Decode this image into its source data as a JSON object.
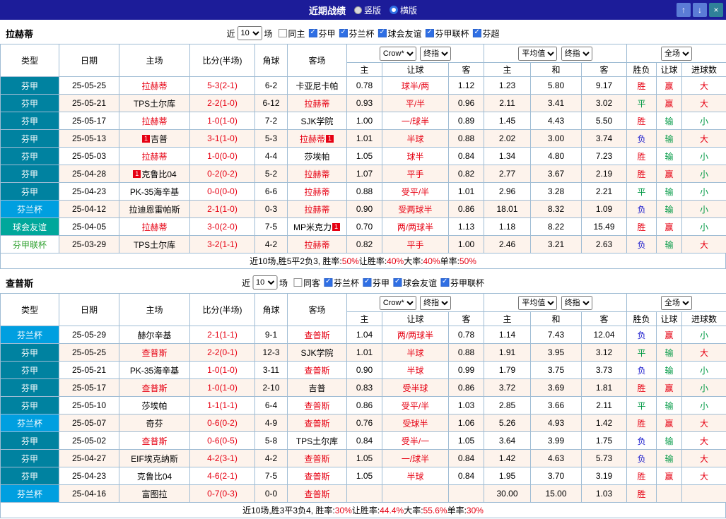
{
  "topbar": {
    "title": "近期战绩",
    "radios": [
      {
        "label": "竖版",
        "selected": false
      },
      {
        "label": "横版",
        "selected": true
      }
    ],
    "buttons": {
      "up": "↑",
      "down": "↓",
      "close": "×"
    }
  },
  "columns": {
    "type": "类型",
    "date": "日期",
    "home": "主场",
    "score": "比分(半场)",
    "corner": "角球",
    "away": "客场",
    "bookmaker": "Crow*",
    "final_index": "终指",
    "average": "平均值",
    "final_index2": "终指",
    "full_match": "全场",
    "odds_sub": [
      "主",
      "让球",
      "客"
    ],
    "avg_sub": [
      "主",
      "和",
      "客"
    ],
    "result_sub": [
      "胜负",
      "让球",
      "进球数"
    ]
  },
  "sections": [
    {
      "team": "拉赫蒂",
      "filter": {
        "near_label": "近",
        "count": "10",
        "matches_label": "场",
        "same_venue": {
          "label": "同主",
          "checked": false
        },
        "leagues": [
          {
            "label": "芬甲",
            "checked": true
          },
          {
            "label": "芬兰杯",
            "checked": true
          },
          {
            "label": "球会友谊",
            "checked": true
          },
          {
            "label": "芬甲联杯",
            "checked": true
          },
          {
            "label": "芬超",
            "checked": true
          }
        ]
      },
      "rows": [
        {
          "league": "芬甲",
          "date": "25-05-25",
          "home": {
            "name": "拉赫蒂",
            "focus": true
          },
          "score": "5-3(2-1)",
          "corner": "6-2",
          "away": {
            "name": "卡亚尼卡帕",
            "focus": false
          },
          "odds": {
            "home": "0.78",
            "handicap": "球半/两",
            "away": "1.12"
          },
          "avg": {
            "home": "1.23",
            "draw": "5.80",
            "away": "9.17"
          },
          "result": "胜",
          "handicap_result": "赢",
          "goals": "大"
        },
        {
          "league": "芬甲",
          "date": "25-05-21",
          "home": {
            "name": "TPS土尔库",
            "focus": false
          },
          "score": "2-2(1-0)",
          "corner": "6-12",
          "away": {
            "name": "拉赫蒂",
            "focus": true
          },
          "odds": {
            "home": "0.93",
            "handicap": "平/半",
            "away": "0.96"
          },
          "avg": {
            "home": "2.11",
            "draw": "3.41",
            "away": "3.02"
          },
          "result": "平",
          "handicap_result": "赢",
          "goals": "大"
        },
        {
          "league": "芬甲",
          "date": "25-05-17",
          "home": {
            "name": "拉赫蒂",
            "focus": true
          },
          "score": "1-0(1-0)",
          "corner": "7-2",
          "away": {
            "name": "SJK学院",
            "focus": false
          },
          "odds": {
            "home": "1.00",
            "handicap": "一/球半",
            "away": "0.89"
          },
          "avg": {
            "home": "1.45",
            "draw": "4.43",
            "away": "5.50"
          },
          "result": "胜",
          "handicap_result": "输",
          "goals": "小"
        },
        {
          "league": "芬甲",
          "date": "25-05-13",
          "home": {
            "name": "吉普",
            "focus": false,
            "badge_pre": "1"
          },
          "score": "3-1(1-0)",
          "corner": "5-3",
          "away": {
            "name": "拉赫蒂",
            "focus": true,
            "badge_post": "1"
          },
          "odds": {
            "home": "1.01",
            "handicap": "半球",
            "away": "0.88"
          },
          "avg": {
            "home": "2.02",
            "draw": "3.00",
            "away": "3.74"
          },
          "result": "负",
          "handicap_result": "输",
          "goals": "大"
        },
        {
          "league": "芬甲",
          "date": "25-05-03",
          "home": {
            "name": "拉赫蒂",
            "focus": true
          },
          "score": "1-0(0-0)",
          "corner": "4-4",
          "away": {
            "name": "莎埃帕",
            "focus": false
          },
          "odds": {
            "home": "1.05",
            "handicap": "球半",
            "away": "0.84"
          },
          "avg": {
            "home": "1.34",
            "draw": "4.80",
            "away": "7.23"
          },
          "result": "胜",
          "handicap_result": "输",
          "goals": "小"
        },
        {
          "league": "芬甲",
          "date": "25-04-28",
          "home": {
            "name": "克鲁比04",
            "focus": false,
            "badge_pre": "1"
          },
          "score": "0-2(0-2)",
          "corner": "5-2",
          "away": {
            "name": "拉赫蒂",
            "focus": true
          },
          "odds": {
            "home": "1.07",
            "handicap": "平手",
            "away": "0.82"
          },
          "avg": {
            "home": "2.77",
            "draw": "3.67",
            "away": "2.19"
          },
          "result": "胜",
          "handicap_result": "赢",
          "goals": "小"
        },
        {
          "league": "芬甲",
          "date": "25-04-23",
          "home": {
            "name": "PK-35海辛基",
            "focus": false
          },
          "score": "0-0(0-0)",
          "corner": "6-6",
          "away": {
            "name": "拉赫蒂",
            "focus": true
          },
          "odds": {
            "home": "0.88",
            "handicap": "受平/半",
            "away": "1.01"
          },
          "avg": {
            "home": "2.96",
            "draw": "3.28",
            "away": "2.21"
          },
          "result": "平",
          "handicap_result": "输",
          "goals": "小"
        },
        {
          "league": "芬兰杯",
          "date": "25-04-12",
          "home": {
            "name": "拉迪恩雷帕斯",
            "focus": false
          },
          "score": "2-1(1-0)",
          "corner": "0-3",
          "away": {
            "name": "拉赫蒂",
            "focus": true
          },
          "odds": {
            "home": "0.90",
            "handicap": "受两球半",
            "away": "0.86"
          },
          "avg": {
            "home": "18.01",
            "draw": "8.32",
            "away": "1.09"
          },
          "result": "负",
          "handicap_result": "输",
          "goals": "小"
        },
        {
          "league": "球会友谊",
          "date": "25-04-05",
          "home": {
            "name": "拉赫蒂",
            "focus": true
          },
          "score": "3-0(2-0)",
          "corner": "7-5",
          "away": {
            "name": "MP米克力",
            "focus": false,
            "badge_post": "1"
          },
          "odds": {
            "home": "0.70",
            "handicap": "两/两球半",
            "away": "1.13"
          },
          "avg": {
            "home": "1.18",
            "draw": "8.22",
            "away": "15.49"
          },
          "result": "胜",
          "handicap_result": "赢",
          "goals": "小"
        },
        {
          "league": "芬甲联杯",
          "date": "25-03-29",
          "home": {
            "name": "TPS土尔库",
            "focus": false
          },
          "score": "3-2(1-1)",
          "corner": "4-2",
          "away": {
            "name": "拉赫蒂",
            "focus": true
          },
          "odds": {
            "home": "0.82",
            "handicap": "平手",
            "away": "1.00"
          },
          "avg": {
            "home": "2.46",
            "draw": "3.21",
            "away": "2.63"
          },
          "result": "负",
          "handicap_result": "输",
          "goals": "大"
        }
      ],
      "summary": [
        {
          "text": "近10场,胜5平2负3, 胜率:",
          "red": false
        },
        {
          "text": "50%",
          "red": true
        },
        {
          "text": " 让胜率:",
          "red": false
        },
        {
          "text": "40%",
          "red": true
        },
        {
          "text": " 大率:",
          "red": false
        },
        {
          "text": "40%",
          "red": true
        },
        {
          "text": " 单率:",
          "red": false
        },
        {
          "text": "50%",
          "red": true
        }
      ]
    },
    {
      "team": "查普斯",
      "filter": {
        "near_label": "近",
        "count": "10",
        "matches_label": "场",
        "same_venue": {
          "label": "同客",
          "checked": false
        },
        "leagues": [
          {
            "label": "芬兰杯",
            "checked": true
          },
          {
            "label": "芬甲",
            "checked": true
          },
          {
            "label": "球会友谊",
            "checked": true
          },
          {
            "label": "芬甲联杯",
            "checked": true
          }
        ]
      },
      "rows": [
        {
          "league": "芬兰杯",
          "date": "25-05-29",
          "home": {
            "name": "赫尔辛基",
            "focus": false
          },
          "score": "2-1(1-1)",
          "corner": "9-1",
          "away": {
            "name": "查普斯",
            "focus": true
          },
          "odds": {
            "home": "1.04",
            "handicap": "两/两球半",
            "away": "0.78"
          },
          "avg": {
            "home": "1.14",
            "draw": "7.43",
            "away": "12.04"
          },
          "result": "负",
          "handicap_result": "赢",
          "goals": "小"
        },
        {
          "league": "芬甲",
          "date": "25-05-25",
          "home": {
            "name": "查普斯",
            "focus": true
          },
          "score": "2-2(0-1)",
          "corner": "12-3",
          "away": {
            "name": "SJK学院",
            "focus": false
          },
          "odds": {
            "home": "1.01",
            "handicap": "半球",
            "away": "0.88"
          },
          "avg": {
            "home": "1.91",
            "draw": "3.95",
            "away": "3.12"
          },
          "result": "平",
          "handicap_result": "输",
          "goals": "大"
        },
        {
          "league": "芬甲",
          "date": "25-05-21",
          "home": {
            "name": "PK-35海辛基",
            "focus": false
          },
          "score": "1-0(1-0)",
          "corner": "3-11",
          "away": {
            "name": "查普斯",
            "focus": true
          },
          "odds": {
            "home": "0.90",
            "handicap": "半球",
            "away": "0.99"
          },
          "avg": {
            "home": "1.79",
            "draw": "3.75",
            "away": "3.73"
          },
          "result": "负",
          "handicap_result": "输",
          "goals": "小"
        },
        {
          "league": "芬甲",
          "date": "25-05-17",
          "home": {
            "name": "查普斯",
            "focus": true
          },
          "score": "1-0(1-0)",
          "corner": "2-10",
          "away": {
            "name": "吉普",
            "focus": false
          },
          "odds": {
            "home": "0.83",
            "handicap": "受半球",
            "away": "0.86"
          },
          "avg": {
            "home": "3.72",
            "draw": "3.69",
            "away": "1.81"
          },
          "result": "胜",
          "handicap_result": "赢",
          "goals": "小"
        },
        {
          "league": "芬甲",
          "date": "25-05-10",
          "home": {
            "name": "莎埃帕",
            "focus": false
          },
          "score": "1-1(1-1)",
          "corner": "6-4",
          "away": {
            "name": "查普斯",
            "focus": true
          },
          "odds": {
            "home": "0.86",
            "handicap": "受平/半",
            "away": "1.03"
          },
          "avg": {
            "home": "2.85",
            "draw": "3.66",
            "away": "2.11"
          },
          "result": "平",
          "handicap_result": "输",
          "goals": "小"
        },
        {
          "league": "芬兰杯",
          "date": "25-05-07",
          "home": {
            "name": "奇芬",
            "focus": false
          },
          "score": "0-6(0-2)",
          "corner": "4-9",
          "away": {
            "name": "查普斯",
            "focus": true
          },
          "odds": {
            "home": "0.76",
            "handicap": "受球半",
            "away": "1.06"
          },
          "avg": {
            "home": "5.26",
            "draw": "4.93",
            "away": "1.42"
          },
          "result": "胜",
          "handicap_result": "赢",
          "goals": "大"
        },
        {
          "league": "芬甲",
          "date": "25-05-02",
          "home": {
            "name": "查普斯",
            "focus": true
          },
          "score": "0-6(0-5)",
          "corner": "5-8",
          "away": {
            "name": "TPS土尔库",
            "focus": false
          },
          "odds": {
            "home": "0.84",
            "handicap": "受半/一",
            "away": "1.05"
          },
          "avg": {
            "home": "3.64",
            "draw": "3.99",
            "away": "1.75"
          },
          "result": "负",
          "handicap_result": "输",
          "goals": "大"
        },
        {
          "league": "芬甲",
          "date": "25-04-27",
          "home": {
            "name": "EIF埃克纳斯",
            "focus": false
          },
          "score": "4-2(3-1)",
          "corner": "4-2",
          "away": {
            "name": "查普斯",
            "focus": true
          },
          "odds": {
            "home": "1.05",
            "handicap": "一/球半",
            "away": "0.84"
          },
          "avg": {
            "home": "1.42",
            "draw": "4.63",
            "away": "5.73"
          },
          "result": "负",
          "handicap_result": "输",
          "goals": "大"
        },
        {
          "league": "芬甲",
          "date": "25-04-23",
          "home": {
            "name": "克鲁比04",
            "focus": false
          },
          "score": "4-6(2-1)",
          "corner": "7-5",
          "away": {
            "name": "查普斯",
            "focus": true
          },
          "odds": {
            "home": "1.05",
            "handicap": "半球",
            "away": "0.84"
          },
          "avg": {
            "home": "1.95",
            "draw": "3.70",
            "away": "3.19"
          },
          "result": "胜",
          "handicap_result": "赢",
          "goals": "大"
        },
        {
          "league": "芬兰杯",
          "date": "25-04-16",
          "home": {
            "name": "富图拉",
            "focus": false
          },
          "score": "0-7(0-3)",
          "corner": "0-0",
          "away": {
            "name": "查普斯",
            "focus": true
          },
          "odds": {
            "home": "",
            "handicap": "",
            "away": ""
          },
          "avg": {
            "home": "30.00",
            "draw": "15.00",
            "away": "1.03"
          },
          "result": "胜",
          "handicap_result": "",
          "goals": ""
        }
      ],
      "summary": [
        {
          "text": "近10场,胜3平3负4, 胜率:",
          "red": false
        },
        {
          "text": "30%",
          "red": true
        },
        {
          "text": " 让胜率:",
          "red": false
        },
        {
          "text": "44.4%",
          "red": true
        },
        {
          "text": " 大率:",
          "red": false
        },
        {
          "text": "55.6%",
          "red": true
        },
        {
          "text": " 单率:",
          "red": false
        },
        {
          "text": "30%",
          "red": true
        }
      ]
    }
  ]
}
